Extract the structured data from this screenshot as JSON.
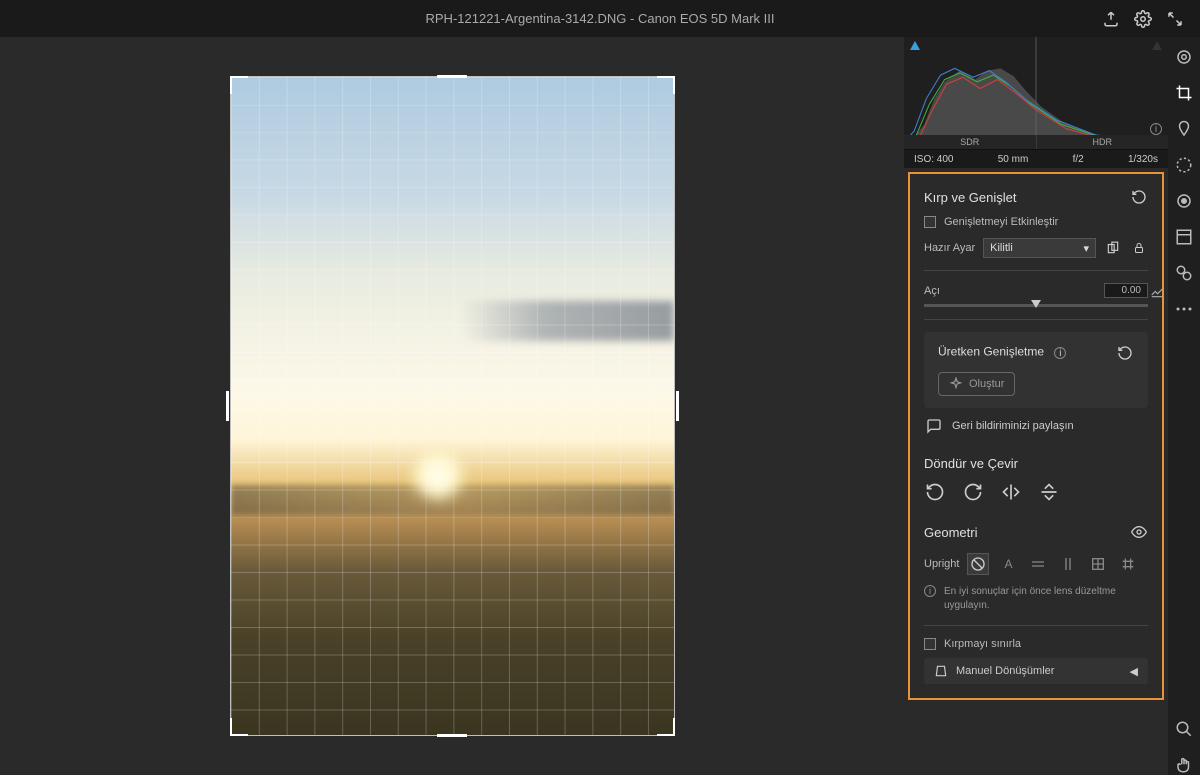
{
  "topbar": {
    "filename": "RPH-121221-Argentina-3142.DNG",
    "camera": "Canon EOS 5D Mark III",
    "separator": "  -  "
  },
  "histogram": {
    "sdr": "SDR",
    "hdr": "HDR"
  },
  "meta": {
    "iso": "ISO: 400",
    "focal": "50 mm",
    "aperture": "f/2",
    "shutter": "1/320s"
  },
  "crop": {
    "title": "Kırp ve Genişlet",
    "enable_expand": "Genişletmeyi Etkinleştir",
    "preset_label": "Hazır Ayar",
    "preset_value": "Kilitli",
    "angle_label": "Açı",
    "angle_value": "0.00"
  },
  "gen": {
    "title": "Üretken Genişletme",
    "btn": "Oluştur"
  },
  "feedback": "Geri bildiriminizi paylaşın",
  "rotate": {
    "title": "Döndür ve Çevir"
  },
  "geometry": {
    "title": "Geometri",
    "upright_label": "Upright",
    "hint": "En iyi sonuçlar için önce lens düzeltme uygulayın.",
    "constrain_crop": "Kırpmayı sınırla",
    "manual": "Manuel Dönüşümler"
  }
}
